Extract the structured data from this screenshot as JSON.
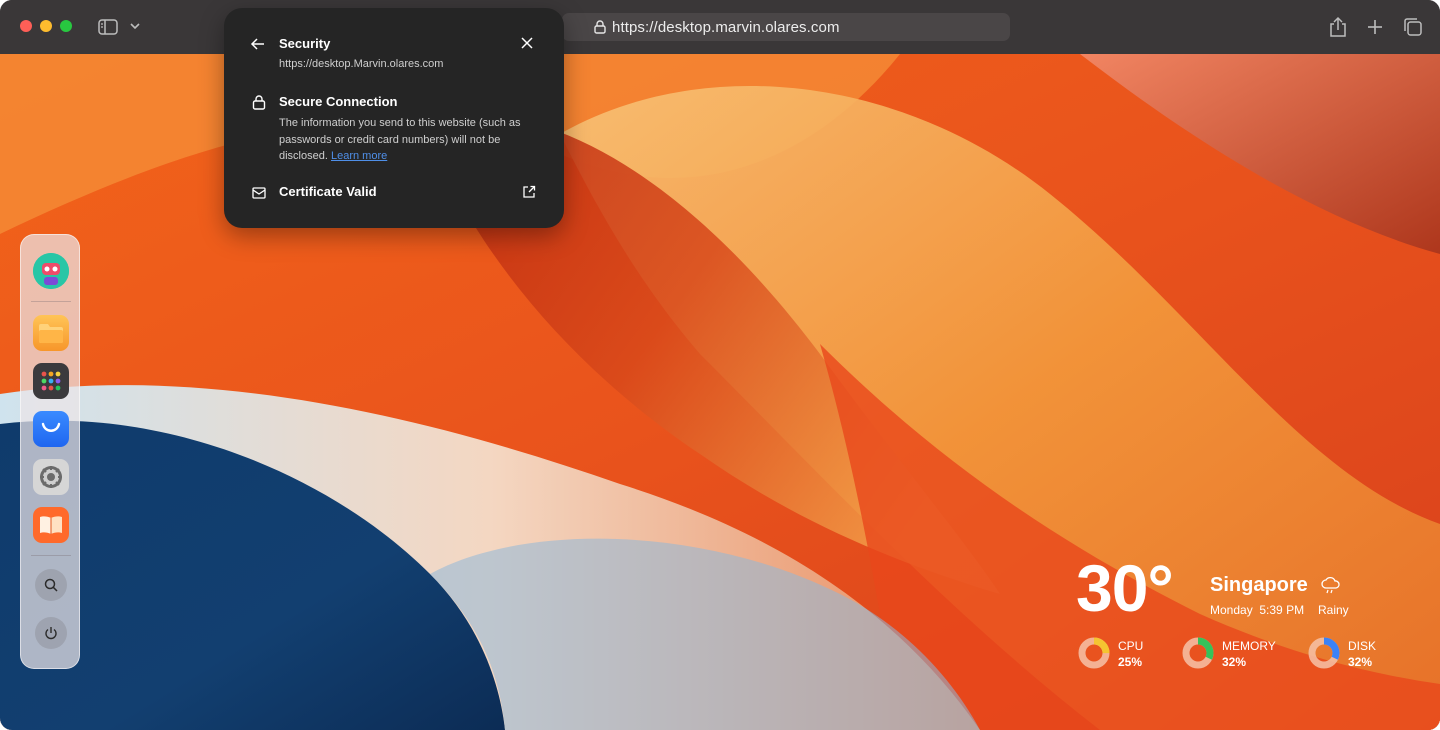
{
  "browser": {
    "url": "https://desktop.marvin.olares.com"
  },
  "security_popover": {
    "title": "Security",
    "url": "https://desktop.Marvin.olares.com",
    "connection_title": "Secure Connection",
    "connection_desc": "The information you send to this website (such as passwords or credit card numbers) will not be disclosed.",
    "learn_more": "Learn more",
    "certificate": "Certificate Valid"
  },
  "dock": {
    "items": [
      {
        "name": "avatar"
      },
      {
        "name": "files-folder-icon"
      },
      {
        "name": "launchpad-grid-icon"
      },
      {
        "name": "market-bag-icon"
      },
      {
        "name": "settings-gear-icon"
      },
      {
        "name": "wise-book-icon"
      },
      {
        "name": "search-icon"
      },
      {
        "name": "power-icon"
      }
    ]
  },
  "widget": {
    "temperature": "30°",
    "city": "Singapore",
    "day": "Monday",
    "time": "5:39 PM",
    "condition": "Rainy",
    "gauges": [
      {
        "label": "CPU",
        "value": "25%",
        "percent": 25,
        "color": "#f5c431"
      },
      {
        "label": "MEMORY",
        "value": "32%",
        "percent": 32,
        "color": "#35c25a"
      },
      {
        "label": "DISK",
        "value": "32%",
        "percent": 32,
        "color": "#3b82f6"
      }
    ]
  },
  "colors": {
    "popover_bg": "#252525",
    "link": "#4f8fe8",
    "toolbar_bg": "#3a3738"
  }
}
